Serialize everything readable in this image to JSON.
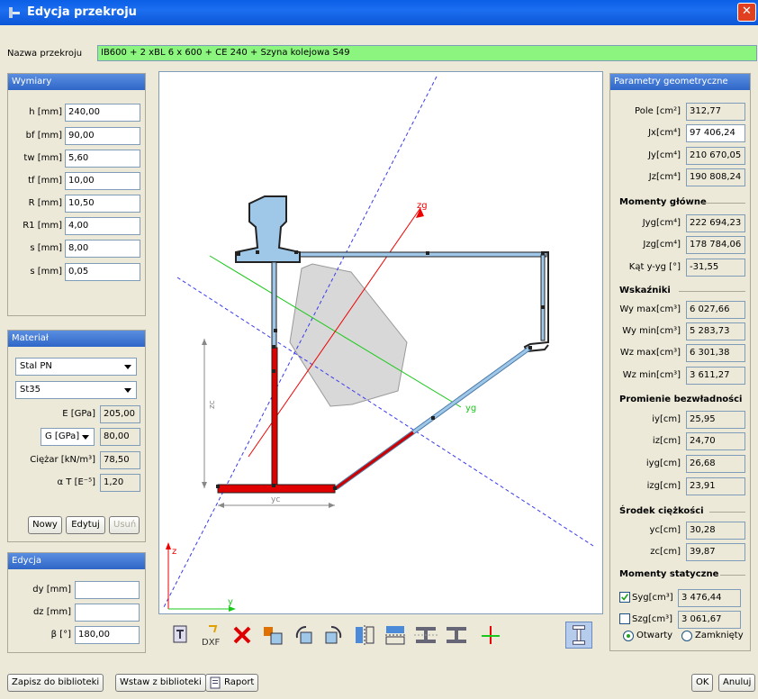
{
  "window": {
    "title": "Edycja przekroju",
    "close": "✕"
  },
  "name": {
    "label": "Nazwa przekroju",
    "value": "IB600 + 2 xBL 6 x 600 + CE 240  + Szyna kolejowa S49"
  },
  "wymiary": {
    "title": "Wymiary",
    "fields": [
      {
        "label": "h [mm]",
        "value": "240,00"
      },
      {
        "label": "bf [mm]",
        "value": "90,00"
      },
      {
        "label": "tw [mm]",
        "value": "5,60"
      },
      {
        "label": "tf [mm]",
        "value": "10,00"
      },
      {
        "label": "R [mm]",
        "value": "10,50"
      },
      {
        "label": "R1 [mm]",
        "value": "4,00"
      },
      {
        "label": "s [mm]",
        "value": "8,00"
      },
      {
        "label": "s [mm]",
        "value": "0,05"
      }
    ]
  },
  "material": {
    "title": "Materiał",
    "type": "Stal PN",
    "grade": "St35",
    "e_label": "E [GPa]",
    "e_value": "205,00",
    "g_label": "G [GPa]",
    "g_value": "80,00",
    "ciezar_label": "Ciężar [kN/m³]",
    "ciezar_value": "78,50",
    "at_label": "α T [E⁻⁵]",
    "at_value": "1,20",
    "new_btn": "Nowy",
    "edit_btn": "Edytuj",
    "del_btn": "Usuń"
  },
  "edycja": {
    "title": "Edycja",
    "dy_label": "dy [mm]",
    "dy_value": "",
    "dz_label": "dz [mm]",
    "dz_value": "",
    "beta_label": "β [°]",
    "beta_value": "180,00"
  },
  "params": {
    "title": "Parametry geometryczne",
    "rows1": [
      {
        "label": "Pole [cm²]",
        "value": "312,77"
      },
      {
        "label": "Jx[cm⁴]",
        "value": "97 406,24"
      },
      {
        "label": "Jy[cm⁴]",
        "value": "210 670,05"
      },
      {
        "label": "Jz[cm⁴]",
        "value": "190 808,24"
      }
    ],
    "moments_title": "Momenty główne",
    "moments": [
      {
        "label": "Jyg[cm⁴]",
        "value": "222 694,23"
      },
      {
        "label": "Jzg[cm⁴]",
        "value": "178 784,06"
      },
      {
        "label": "Kąt y-yg [°]",
        "value": "-31,55"
      }
    ],
    "wsk_title": "Wskaźniki",
    "wsk": [
      {
        "label": "Wy max[cm³]",
        "value": "6 027,66"
      },
      {
        "label": "Wy min[cm³]",
        "value": "5 283,73"
      },
      {
        "label": "Wz max[cm³]",
        "value": "6 301,38"
      },
      {
        "label": "Wz min[cm³]",
        "value": "3 611,27"
      }
    ],
    "prom_title": "Promienie bezwładności",
    "prom": [
      {
        "label": "iy[cm]",
        "value": "25,95"
      },
      {
        "label": "iz[cm]",
        "value": "24,70"
      },
      {
        "label": "iyg[cm]",
        "value": "26,68"
      },
      {
        "label": "izg[cm]",
        "value": "23,91"
      }
    ],
    "sr_title": "Środek ciężkości",
    "sr": [
      {
        "label": "yc[cm]",
        "value": "30,28"
      },
      {
        "label": "zc[cm]",
        "value": "39,87"
      }
    ],
    "ms_title": "Momenty statyczne",
    "syg_label": "Syg[cm³]",
    "syg_value": "3 476,44",
    "szg_label": "Szg[cm³]",
    "szg_value": "3 061,67",
    "radio_open": "Otwarty",
    "radio_closed": "Zamknięty"
  },
  "canvas": {
    "zg": "zg",
    "yg": "yg",
    "zc": "zc",
    "yc": "yc",
    "z": "z",
    "y": "y"
  },
  "footer": {
    "save": "Zapisz do biblioteki",
    "insert": "Wstaw z biblioteki",
    "report": "Raport",
    "ok": "OK",
    "cancel": "Anuluj"
  },
  "colors": {
    "title_bar": "#1c6ef0",
    "name_bg": "#8cf57f",
    "panel_head": "#2f67c8",
    "section_fill": "#9ec7e8",
    "red": "#e00000"
  }
}
